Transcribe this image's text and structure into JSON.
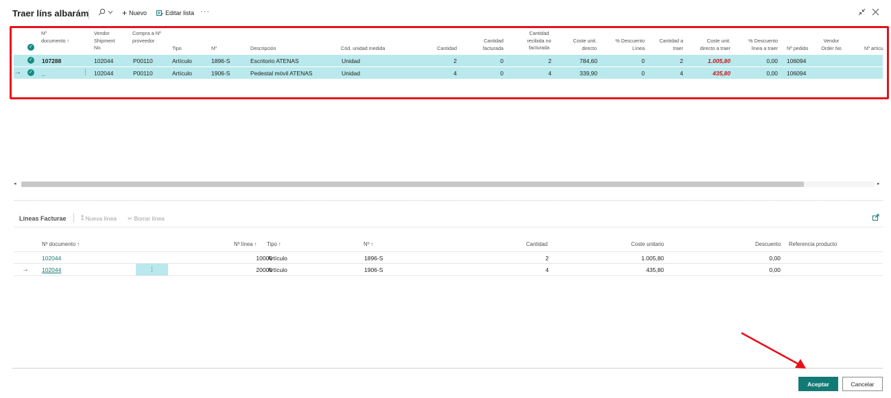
{
  "window": {
    "title": "Traer líns albarám",
    "new_label": "Nuevo",
    "edit_list_label": "Editar lista",
    "more_label": "···"
  },
  "main_grid": {
    "headers": {
      "doc": "Nº documento ↑",
      "vendor_shipment": "Vendor Shipment No.",
      "vendor_no": "Compra a-Nº proveedor",
      "type": "Tipo",
      "no": "Nº",
      "description": "Descripción",
      "uom": "Cód. unidad medida",
      "qty": "Cantidad",
      "qty_invoiced": "Cantidad facturada",
      "qty_received": "Cantidad recibida no facturada",
      "unit_cost": "Coste unit. directo",
      "disc": "% Descuento Línea",
      "qty_to_bring": "Cantidad a traer",
      "unit_cost_bring": "Coste unit. directo a traer",
      "disc_bring": "% Descuento línea a traer",
      "order_no": "Nº pedido",
      "vendor_order": "Vendor Order No",
      "item_no": "Nº artícu"
    },
    "rows": [
      {
        "doc": "107288",
        "vendor_shipment": "102044",
        "vendor_no": "P00110",
        "type": "Artículo",
        "no": "1896-S",
        "description": "Escritorio ATENAS",
        "uom": "Unidad",
        "qty": "2",
        "qty_invoiced": "0",
        "qty_received": "2",
        "unit_cost": "784,60",
        "disc": "0",
        "qty_to_bring": "2",
        "unit_cost_bring": "1.005,80",
        "disc_bring": "0,00",
        "order_no": "106094"
      },
      {
        "doc": "_",
        "vendor_shipment": "102044",
        "vendor_no": "P00110",
        "type": "Artículo",
        "no": "1906-S",
        "description": "Pedestal móvil ATENAS",
        "uom": "Unidad",
        "qty": "4",
        "qty_invoiced": "0",
        "qty_received": "4",
        "unit_cost": "339,90",
        "disc": "0",
        "qty_to_bring": "4",
        "unit_cost_bring": "435,80",
        "disc_bring": "0,00",
        "order_no": "106094"
      }
    ]
  },
  "part": {
    "title": "Líneas Facturae",
    "new_line": "Nueva línea",
    "delete_line": "Borrar línea",
    "headers": {
      "doc": "Nº documento ↑",
      "line": "Nº línea ↑",
      "type": "Tipo ↑",
      "no": "Nº ↑",
      "qty": "Cantidad",
      "unit_cost": "Coste unitario",
      "discount": "Descuento",
      "product_ref": "Referencia producto"
    },
    "rows": [
      {
        "doc": "102044",
        "line": "10000",
        "type": "Artículo",
        "no": "1896-S",
        "qty": "2",
        "unit_cost": "1.005,80",
        "discount": "0,00"
      },
      {
        "doc": "102044",
        "line": "20000",
        "type": "Artículo",
        "no": "1906-S",
        "qty": "4",
        "unit_cost": "435,80",
        "discount": "0,00"
      }
    ]
  },
  "footer": {
    "accept": "Aceptar",
    "cancel": "Cancelar"
  },
  "colors": {
    "accent": "#127a74",
    "selected_row": "#b9e9ec",
    "highlight_red": "#e8101a"
  }
}
